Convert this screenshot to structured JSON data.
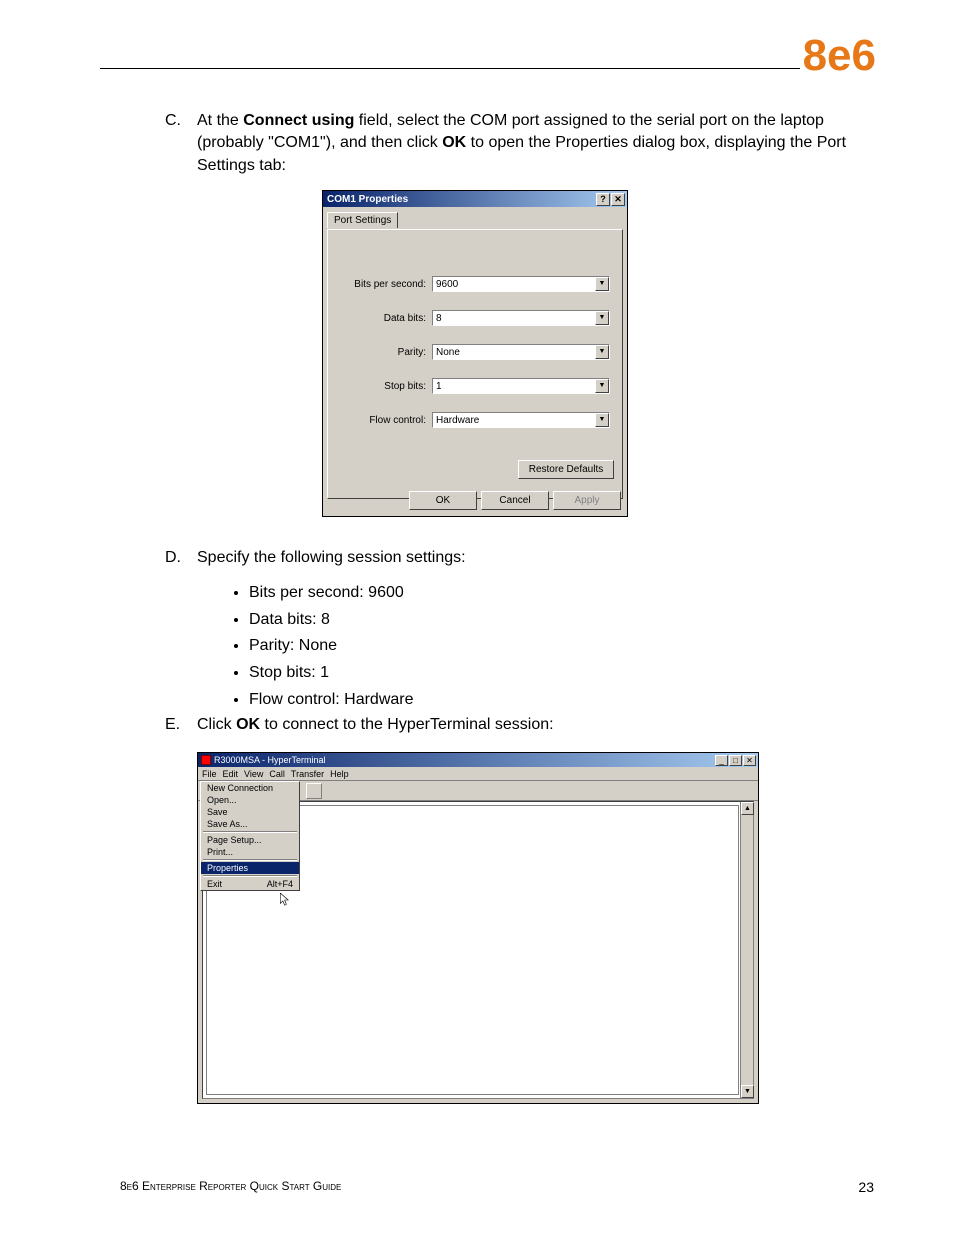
{
  "branding": {
    "logo": "8e6"
  },
  "steps": {
    "c": {
      "label": "C.",
      "pre": "At the ",
      "field_bold": "Connect using",
      "mid1": " field, select the COM port assigned to the serial port on the laptop (probably \"COM1\"), and then click ",
      "ok_bold": "OK",
      "post": " to open the Properties dialog box, displaying the Port Settings tab:"
    },
    "d": {
      "label": "D.",
      "text": "Specify the following session settings:",
      "bullets": [
        "Bits per second: 9600",
        "Data bits: 8",
        "Parity: None",
        "Stop bits: 1",
        "Flow control: Hardware"
      ]
    },
    "e": {
      "label": "E.",
      "pre": "Click ",
      "ok_bold": "OK",
      "post": " to connect to the HyperTerminal session:"
    }
  },
  "dialog1": {
    "title": "COM1 Properties",
    "help_btn": "?",
    "close_btn": "✕",
    "tab": "Port Settings",
    "fields": {
      "bps": {
        "label": "Bits per second:",
        "value": "9600"
      },
      "databits": {
        "label": "Data bits:",
        "value": "8"
      },
      "parity": {
        "label": "Parity:",
        "value": "None"
      },
      "stopbits": {
        "label": "Stop bits:",
        "value": "1"
      },
      "flow": {
        "label": "Flow control:",
        "value": "Hardware"
      }
    },
    "restore": "Restore Defaults",
    "ok": "OK",
    "cancel": "Cancel",
    "apply": "Apply"
  },
  "htwin": {
    "title": "R3000MSA - HyperTerminal",
    "min": "_",
    "max": "□",
    "close": "✕",
    "menubar": [
      "File",
      "Edit",
      "View",
      "Call",
      "Transfer",
      "Help"
    ],
    "filemenu": {
      "new": "New Connection",
      "open": "Open...",
      "save": "Save",
      "saveas": "Save As...",
      "pagesetup": "Page Setup...",
      "print": "Print...",
      "properties": "Properties",
      "exit": "Exit",
      "exit_shortcut": "Alt+F4"
    },
    "scroll_up": "▲",
    "scroll_down": "▼"
  },
  "footer": {
    "text": "8e6 Enterprise Reporter Quick Start Guide",
    "page": "23"
  }
}
